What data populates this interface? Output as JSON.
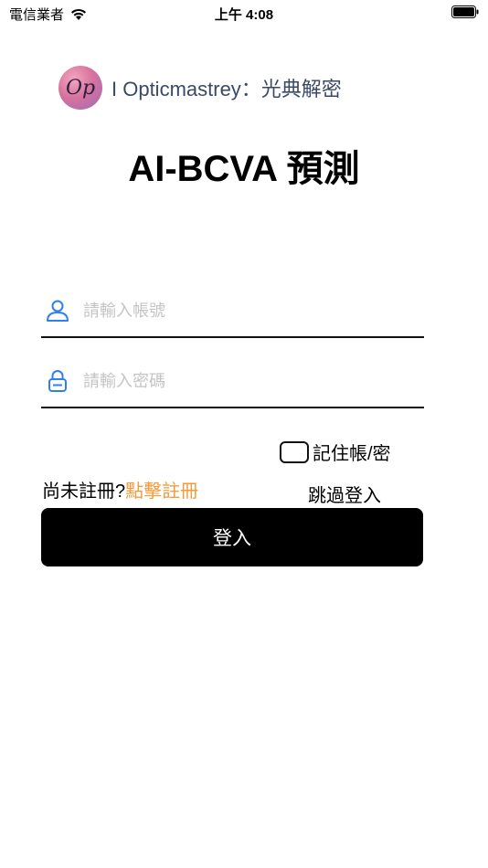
{
  "status_bar": {
    "carrier": "電信業者",
    "time": "上午 4:08"
  },
  "brand": {
    "logo_text": "Op",
    "name": "I Opticmastrey：光典解密"
  },
  "title": "AI-BCVA 預測",
  "form": {
    "username_placeholder": "請輸入帳號",
    "username_value": "",
    "password_placeholder": "請輸入密碼",
    "password_value": "",
    "remember_label": "記住帳/密",
    "remember_checked": false,
    "not_registered_text": "尚未註冊?",
    "register_link": "點擊註冊",
    "skip_login": "跳過登入",
    "login_button": "登入"
  },
  "colors": {
    "accent_link": "#f39a3a",
    "icon_blue": "#2f80ed",
    "button_bg": "#000000"
  }
}
